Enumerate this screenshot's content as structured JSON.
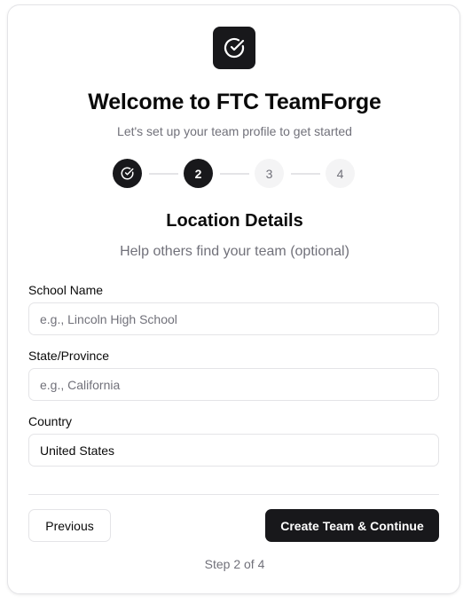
{
  "header": {
    "logo_icon": "check-circle-icon",
    "title": "Welcome to FTC TeamForge",
    "subtitle": "Let's set up your team profile to get started"
  },
  "stepper": {
    "steps": [
      {
        "label": "",
        "status": "done",
        "icon": "check-circle-icon"
      },
      {
        "label": "2",
        "status": "active"
      },
      {
        "label": "3",
        "status": "todo"
      },
      {
        "label": "4",
        "status": "todo"
      }
    ]
  },
  "section": {
    "title": "Location Details",
    "subtitle": "Help others find your team (optional)"
  },
  "form": {
    "school": {
      "label": "School Name",
      "placeholder": "e.g., Lincoln High School",
      "value": ""
    },
    "state": {
      "label": "State/Province",
      "placeholder": "e.g., California",
      "value": ""
    },
    "country": {
      "label": "Country",
      "placeholder": "",
      "value": "United States"
    }
  },
  "actions": {
    "previous_label": "Previous",
    "next_label": "Create Team & Continue"
  },
  "footer": {
    "step_text": "Step 2 of 4"
  },
  "colors": {
    "primary": "#18181b",
    "muted_text": "#71717a",
    "border": "#e4e4e7",
    "step_inactive_bg": "#f4f4f5"
  }
}
